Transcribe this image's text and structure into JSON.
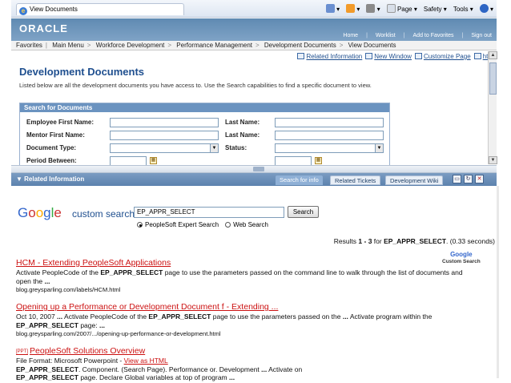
{
  "browser": {
    "tab_title": "View Documents",
    "menu": [
      "Page",
      "Safety",
      "Tools"
    ]
  },
  "oracle": {
    "logo": "ORACLE",
    "top_links": [
      "Home",
      "Worklist",
      "Add to Favorites",
      "Sign out"
    ]
  },
  "nav": {
    "items": [
      "Favorites",
      "Main Menu",
      "Workforce Development",
      "Performance Management",
      "Development Documents",
      "View Documents"
    ]
  },
  "page": {
    "links": [
      "Related Information",
      "New Window",
      "Customize Page",
      "http"
    ],
    "title": "Development Documents",
    "description": "Listed below are all the development documents you have access to. Use the Search capabilities to find a specific document to view."
  },
  "search_form": {
    "header": "Search for Documents",
    "employee_first_name_label": "Employee First Name:",
    "last_name_label_1": "Last Name:",
    "mentor_first_name_label": "Mentor First Name:",
    "last_name_label_2": "Last Name:",
    "document_type_label": "Document Type:",
    "status_label": "Status:",
    "period_between_label": "Period Between:"
  },
  "related": {
    "title": "Related Information",
    "tabs": [
      "Search for info",
      "Related Tickets",
      "Development Wiki"
    ]
  },
  "google": {
    "logo": "Google",
    "subtitle": "custom search",
    "query": "EP_APPR_SELECT",
    "button": "Search",
    "radio_1": "PeopleSoft Expert Search",
    "radio_2": "Web Search",
    "results_prefix": "Results ",
    "results_range": "1 - 3",
    "results_for": " for ",
    "results_query": "EP_APPR_SELECT",
    "results_time": ". (0.33 seconds)",
    "badge_1": "Google",
    "badge_2": "Custom Search"
  },
  "results": [
    {
      "title": "HCM - Extending PeopleSoft Applications",
      "snippet_1": "Activate PeopleCode of the ",
      "snippet_bold": "EP_APPR_SELECT",
      "snippet_2": " page to use the parameters passed on the command line to walk through the list of documents and open the ",
      "snippet_ellipsis": "...",
      "url": "blog.greysparling.com/labels/HCM.html"
    },
    {
      "title": "Opening up a Performance or Development Document f - Extending ...",
      "snippet_1": "Oct 10, 2007 ",
      "snippet_e1": "...",
      "snippet_2": " Activate PeopleCode of the ",
      "snippet_bold": "EP_APPR_SELECT",
      "snippet_3": " page to use the parameters passed on the ",
      "snippet_e2": "...",
      "snippet_4": " Activate program within the ",
      "snippet_bold_2": "EP_APPR_SELECT",
      "snippet_5": " page: ",
      "snippet_e3": "...",
      "url": "blog.greysparling.com/2007/.../opening-up-performance-or-development.html"
    },
    {
      "tag": "[PPT]",
      "title": "PeopleSoft Solutions Overview",
      "format_label": "File Format: Microsoft Powerpoint - ",
      "view_html": "View as HTML",
      "snippet_bold": "EP_APPR_SELECT",
      "snippet_1": ". Component. (Search Page). Performance or. Development ",
      "snippet_e1": "...",
      "snippet_2": " Activate on",
      "snippet_bold_2": "EP_APPR_SELECT",
      "snippet_3": " page. Declare Global variables at top of program ",
      "snippet_e2": "..."
    }
  ]
}
